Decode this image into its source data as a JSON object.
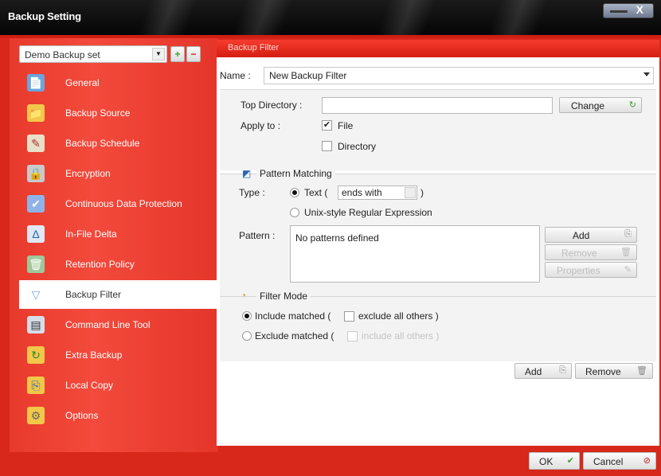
{
  "window": {
    "title": "Backup Setting",
    "close_label": "X"
  },
  "sidebar": {
    "backup_set": "Demo Backup set",
    "add_label": "+",
    "remove_label": "−",
    "items": [
      {
        "label": "General",
        "icon": "📄"
      },
      {
        "label": "Backup Source",
        "icon": "📁"
      },
      {
        "label": "Backup Schedule",
        "icon": "✎"
      },
      {
        "label": "Encryption",
        "icon": "🔒"
      },
      {
        "label": "Continuous Data Protection",
        "icon": "✔"
      },
      {
        "label": "In-File Delta",
        "icon": "Δ"
      },
      {
        "label": "Retention Policy",
        "icon": "🗑"
      },
      {
        "label": "Backup Filter",
        "icon": "▽"
      },
      {
        "label": "Command Line Tool",
        "icon": "▤"
      },
      {
        "label": "Extra Backup",
        "icon": "↻"
      },
      {
        "label": "Local Copy",
        "icon": "⎘"
      },
      {
        "label": "Options",
        "icon": "⚙"
      }
    ]
  },
  "panel": {
    "header": "Backup Filter",
    "name_label": "Name :",
    "name_value": "New Backup Filter",
    "top_directory_label": "Top Directory :",
    "top_directory_value": "",
    "change_label": "Change",
    "apply_to_label": "Apply to :",
    "apply_file": "File",
    "apply_directory": "Directory",
    "pattern_matching_title": "Pattern Matching",
    "type_label": "Type :",
    "type_text": "Text (",
    "type_select": "ends with",
    "type_close": ")",
    "type_regex": "Unix-style Regular Expression",
    "pattern_label": "Pattern :",
    "pattern_empty": "No patterns defined",
    "pattern_add": "Add",
    "pattern_remove": "Remove",
    "pattern_properties": "Properties",
    "filter_mode_title": "Filter Mode",
    "include_matched": "Include matched (",
    "exclude_all_others": "exclude all others )",
    "exclude_matched": "Exclude matched (",
    "include_all_others": "include all others )",
    "add_label": "Add",
    "remove_label": "Remove"
  },
  "footer": {
    "ok_label": "OK",
    "cancel_label": "Cancel"
  },
  "colors": {
    "accent": "#d8271b",
    "titlebar": "#0b0b0b"
  }
}
